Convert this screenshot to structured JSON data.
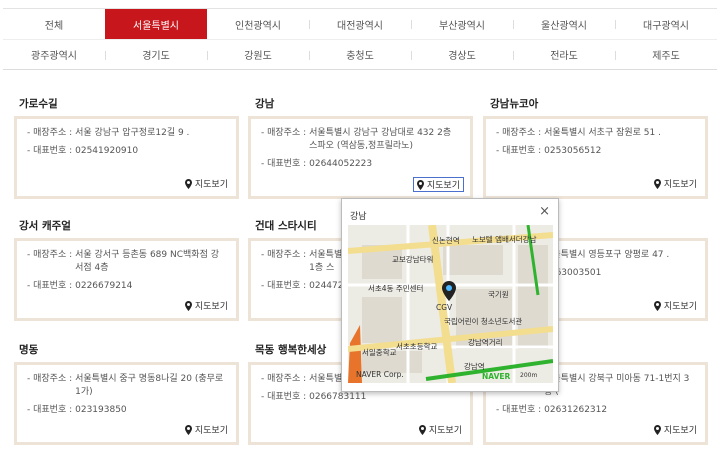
{
  "regions": {
    "row1": [
      "전체",
      "서울특별시",
      "인천광역시",
      "대전광역시",
      "부산광역시",
      "울산광역시",
      "대구광역시"
    ],
    "row2": [
      "광주광역시",
      "경기도",
      "강원도",
      "충청도",
      "경상도",
      "전라도",
      "제주도"
    ],
    "active": "서울특별시"
  },
  "labels": {
    "address": "- 매장주소 :",
    "phone": "- 대표번호 :",
    "map_button": "지도보기"
  },
  "stores": [
    {
      "name": "가로수길",
      "address": "서울 강남구 압구정로12길 9 .",
      "phone": "02541920910"
    },
    {
      "name": "강남",
      "address": "서울특별시 강남구 강남대로 432 2층 스파오 (역삼동,정프릴라노)",
      "phone": "02644052223"
    },
    {
      "name": "강남뉴코아",
      "address": "서울특별시 서초구 잠원로 51 .",
      "phone": "0253056512"
    },
    {
      "name": "강서 캐주얼",
      "address": "서울 강서구 등촌동 689 NC백화점 강서점 4층",
      "phone": "0226679214"
    },
    {
      "name": "건대 스타시티",
      "address": "서울특별시 광진구 능동로 92 스타시티 1층 스",
      "phone": "024472"
    },
    {
      "name": "",
      "address": "서울특별시 영등포구 양평로 47 .",
      "phone": "0263003501"
    },
    {
      "name": "명동",
      "address": "서울특별시 중구 명동8나길 20 (충무로1가)",
      "phone": "023193850"
    },
    {
      "name": "목동 행복한세상",
      "address": "서울특별시 양천구",
      "phone": "0266783111"
    },
    {
      "name": "",
      "address": "서울특별시 강북구 미아동 71-1번지 3층 (",
      "phone": "02631262312"
    }
  ],
  "popup": {
    "title": "강남",
    "close": "×",
    "map_labels": [
      "신논현역",
      "노보텔 앰배서더강남",
      "교보강남타워",
      "서초4동 주민센터",
      "CGV",
      "국기원",
      "국립어린이 청소년도서관",
      "서일중학교",
      "서초초등학교",
      "강남역거리",
      "NAVER Corp.",
      "강남역",
      "NAVER",
      "200m"
    ]
  },
  "colors": {
    "accent": "#c8161d",
    "card_border": "#ede3d6",
    "map_road": "#f3dd8f",
    "map_green": "#2fb32f",
    "map_base": "#ecebe4"
  },
  "icons": {
    "map_pin": "map-pin-icon",
    "close": "close-icon"
  }
}
